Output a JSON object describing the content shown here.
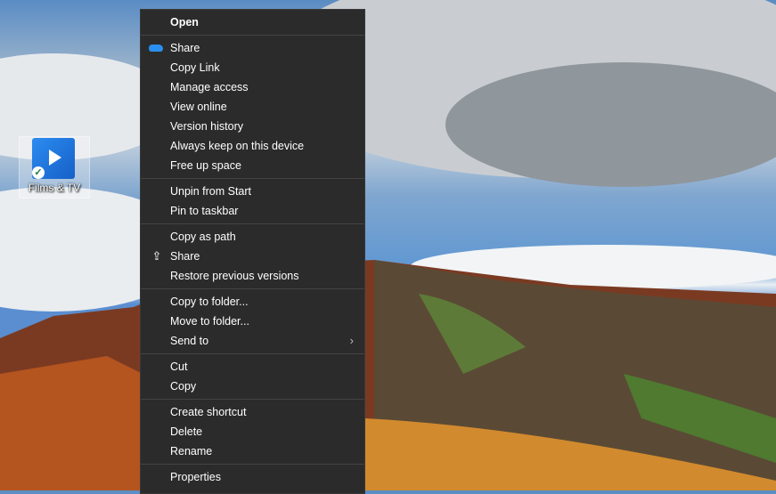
{
  "desktop": {
    "icon_label": "Films & TV"
  },
  "menu": {
    "groups": [
      [
        {
          "label": "Open"
        }
      ],
      [
        {
          "label": "Share"
        },
        {
          "label": "Copy Link"
        },
        {
          "label": "Manage access"
        },
        {
          "label": "View online"
        },
        {
          "label": "Version history"
        },
        {
          "label": "Always keep on this device"
        },
        {
          "label": "Free up space"
        }
      ],
      [
        {
          "label": "Unpin from Start"
        },
        {
          "label": "Pin to taskbar"
        }
      ],
      [
        {
          "label": "Copy as path"
        },
        {
          "label": "Share"
        },
        {
          "label": "Restore previous versions"
        }
      ],
      [
        {
          "label": "Copy to folder..."
        },
        {
          "label": "Move to folder..."
        },
        {
          "label": "Send to"
        }
      ],
      [
        {
          "label": "Cut"
        },
        {
          "label": "Copy"
        }
      ],
      [
        {
          "label": "Create shortcut"
        },
        {
          "label": "Delete"
        },
        {
          "label": "Rename"
        }
      ],
      [
        {
          "label": "Properties"
        }
      ]
    ]
  }
}
